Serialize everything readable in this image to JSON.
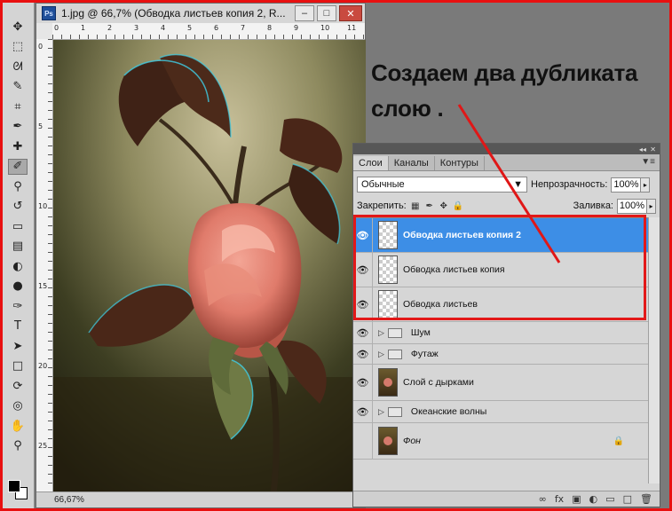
{
  "window": {
    "title": "1.jpg @ 66,7% (Обводка листьев  копия 2, R...",
    "app_badge": "Ps",
    "zoom": "66,67%"
  },
  "annotation": {
    "line1": "Создаем два дубликата",
    "line2": "слою ."
  },
  "panel": {
    "tabs": [
      "Слои",
      "Каналы",
      "Контуры"
    ],
    "blend_mode": "Обычные",
    "opacity_label": "Непрозрачность:",
    "opacity_value": "100%",
    "lock_label": "Закрепить:",
    "fill_label": "Заливка:",
    "fill_value": "100%",
    "layers": [
      {
        "name": "Обводка листьев  копия 2",
        "selected": true,
        "type": "layer"
      },
      {
        "name": "Обводка листьев  копия",
        "type": "layer"
      },
      {
        "name": "Обводка листьев",
        "type": "layer"
      },
      {
        "name": "Шум",
        "type": "group"
      },
      {
        "name": "Футаж",
        "type": "group"
      },
      {
        "name": "Слой с дырками",
        "type": "photo"
      },
      {
        "name": "Океанские волны",
        "type": "group"
      },
      {
        "name": "Фон",
        "type": "background"
      }
    ]
  },
  "ruler": {
    "top": [
      "0",
      "1",
      "2",
      "3",
      "4",
      "5",
      "6",
      "7",
      "8",
      "9",
      "10",
      "11"
    ],
    "left": [
      "0",
      "5",
      "10",
      "15",
      "20",
      "25"
    ]
  },
  "toolbar": {
    "tools": [
      "move",
      "marquee",
      "lasso",
      "quick-select",
      "crop",
      "eyedropper",
      "healing",
      "brush",
      "stamp",
      "history-brush",
      "eraser",
      "gradient",
      "blur",
      "dodge",
      "pen",
      "type",
      "path-select",
      "shape",
      "3d-rotate",
      "3d-camera",
      "hand",
      "zoom"
    ]
  }
}
